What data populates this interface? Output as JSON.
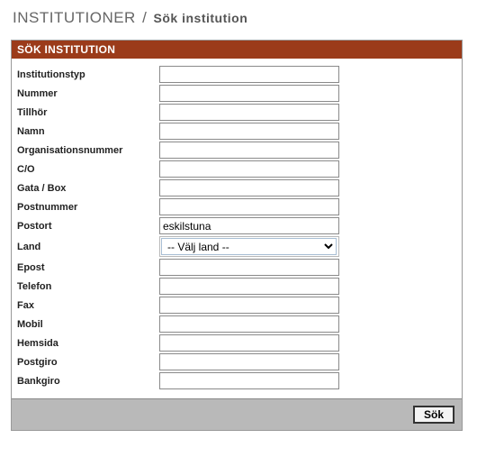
{
  "header": {
    "main": "INSTITUTIONER",
    "separator": "/",
    "sub": "Sök institution"
  },
  "panel": {
    "title": "SÖK INSTITUTION"
  },
  "fields": {
    "institutionstyp": {
      "label": "Institutionstyp",
      "value": ""
    },
    "nummer": {
      "label": "Nummer",
      "value": ""
    },
    "tillhor": {
      "label": "Tillhör",
      "value": ""
    },
    "namn": {
      "label": "Namn",
      "value": ""
    },
    "orgnr": {
      "label": "Organisationsnummer",
      "value": ""
    },
    "co": {
      "label": "C/O",
      "value": ""
    },
    "gata": {
      "label": "Gata / Box",
      "value": ""
    },
    "postnummer": {
      "label": "Postnummer",
      "value": ""
    },
    "postort": {
      "label": "Postort",
      "value": "eskilstuna"
    },
    "land": {
      "label": "Land",
      "selected": "-- Välj land --"
    },
    "epost": {
      "label": "Epost",
      "value": ""
    },
    "telefon": {
      "label": "Telefon",
      "value": ""
    },
    "fax": {
      "label": "Fax",
      "value": ""
    },
    "mobil": {
      "label": "Mobil",
      "value": ""
    },
    "hemsida": {
      "label": "Hemsida",
      "value": ""
    },
    "postgiro": {
      "label": "Postgiro",
      "value": ""
    },
    "bankgiro": {
      "label": "Bankgiro",
      "value": ""
    }
  },
  "actions": {
    "search": "Sök"
  }
}
